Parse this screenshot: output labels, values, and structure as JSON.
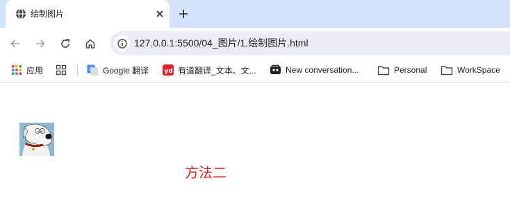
{
  "tab": {
    "title": "绘制图片",
    "favicon": "globe-icon",
    "close_icon": "close-icon",
    "new_tab_icon": "plus-icon"
  },
  "toolbar": {
    "back_icon": "back-arrow-icon",
    "forward_icon": "forward-arrow-icon",
    "reload_icon": "reload-icon",
    "home_icon": "home-icon",
    "site_info_icon": "info-icon",
    "url": "127.0.0.1:5500/04_图片/1.绘制图片.html"
  },
  "bookmarks": [
    {
      "label": "应用",
      "icon": "apps-grid-icon"
    },
    {
      "label": "",
      "icon": "tab-groups-icon"
    },
    {
      "label": "Google 翻译",
      "icon": "google-translate-icon"
    },
    {
      "label": "有道翻译_文本、文...",
      "icon": "youdao-icon"
    },
    {
      "label": "New conversation...",
      "icon": "copilot-icon"
    },
    {
      "label": "Personal",
      "icon": "folder-icon"
    },
    {
      "label": "WorkSpace",
      "icon": "folder-icon"
    }
  ],
  "page": {
    "image_subject": "cartoon-dog-avatar",
    "text": "方法二",
    "text_color": "#e0231b"
  },
  "colors": {
    "tabstrip": "#d3e3fd",
    "omnibox": "#e9eef6",
    "icon": "#474747"
  }
}
